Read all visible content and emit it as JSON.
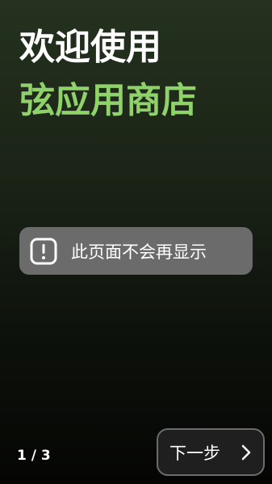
{
  "welcome": {
    "line1": "欢迎使用",
    "line2": "弦应用商店",
    "accent_color": "#8fd16a"
  },
  "toast": {
    "icon": "exclamation-icon",
    "text": "此页面不会再显示"
  },
  "footer": {
    "page_indicator": "1 / 3",
    "next_label": "下一步",
    "next_icon": "chevron-right-icon"
  }
}
